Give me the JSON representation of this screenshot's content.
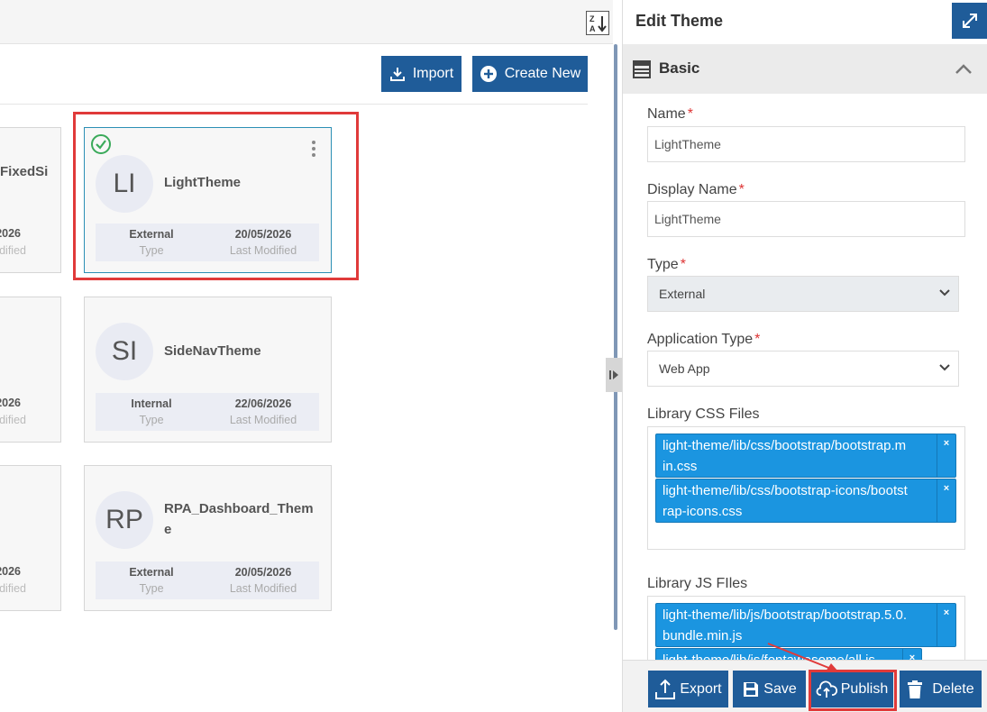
{
  "toolbar": {
    "sort_icon": "sort-za-icon",
    "import_label": "Import",
    "create_label": "Create New"
  },
  "cards": [
    {
      "initials": "LI",
      "name": "LightTheme",
      "type": "External",
      "type_label": "Type",
      "modified": "20/05/2026",
      "modified_label": "Last Modified",
      "selected": true
    },
    {
      "initials": "SI",
      "name": "SideNavTheme",
      "type": "Internal",
      "type_label": "Type",
      "modified": "22/06/2026",
      "modified_label": "Last Modified"
    },
    {
      "initials": "RP",
      "name": "RPA_Dashboard_Them",
      "name_wrap": "e",
      "type": "External",
      "type_label": "Type",
      "modified": "20/05/2026",
      "modified_label": "Last Modified"
    }
  ],
  "partial_cards": [
    {
      "title": "FixedSi",
      "date": "2026",
      "label": "dified"
    },
    {
      "date": "2026",
      "label": "dified"
    },
    {
      "date": "2026",
      "label": "dified"
    }
  ],
  "panel": {
    "title": "Edit Theme",
    "section": "Basic",
    "fields": {
      "name_label": "Name",
      "name_value": "LightTheme",
      "display_label": "Display Name",
      "display_value": "LightTheme",
      "type_label": "Type",
      "type_value": "External",
      "app_type_label": "Application Type",
      "app_type_value": "Web App",
      "css_label": "Library CSS Files",
      "css_files": [
        {
          "line1": "light-theme/lib/css/bootstrap/bootstrap.m",
          "line2": "in.css"
        },
        {
          "line1": "light-theme/lib/css/bootstrap-icons/bootst",
          "line2": "rap-icons.css"
        }
      ],
      "js_label": "Library JS FIles",
      "js_files": [
        {
          "line1": "light-theme/lib/js/bootstrap/bootstrap.5.0.",
          "line2": "bundle.min.js"
        },
        {
          "line1": "light-theme/lib/js/fontawesome/all.js"
        }
      ],
      "required_mark": "*",
      "remove_mark": "×"
    },
    "footer": {
      "export_label": "Export",
      "save_label": "Save",
      "publish_label": "Publish",
      "delete_label": "Delete"
    }
  },
  "colors": {
    "primary": "#1f5c99",
    "tag": "#1b95e0",
    "highlight": "#e03a3a",
    "check": "#3aaa5a"
  }
}
